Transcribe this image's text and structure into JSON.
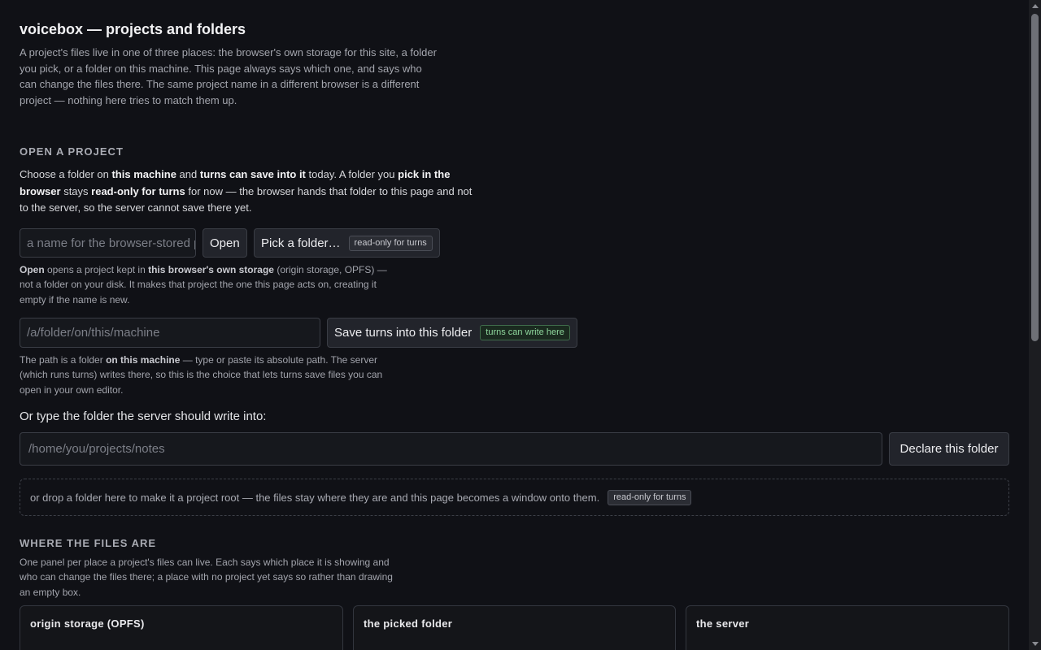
{
  "header": {
    "title": "voicebox — projects and folders",
    "intro": "A project's files live in one of three places: the browser's own storage for this site, a folder you pick, or a folder on this machine. This page always says which one, and says who can change the files there. The same project name in a different browser is a different project — nothing here tries to match them up."
  },
  "open_project": {
    "section_title": "OPEN A PROJECT",
    "lead": {
      "t1": "Choose a folder on ",
      "b1": "this machine",
      "t2": " and ",
      "b2": "turns can save into it",
      "t3": " today. A folder you ",
      "b3": "pick in the browser",
      "t4": " stays ",
      "b4": "read-only for turns",
      "t5": " for now — the browser hands that folder to this page and not to the server, so the server cannot save there yet."
    },
    "name_input_placeholder": "a name for the browser-stored project",
    "open_button": "Open",
    "pick_button": "Pick a folder…",
    "pick_badge": "read-only for turns",
    "open_help": {
      "b1": "Open",
      "t1": " opens a project kept in ",
      "b2": "this browser's own storage",
      "t2": " (origin storage, OPFS) — not a folder on your disk. It makes that project the one this page acts on, creating it empty if the name is new."
    },
    "path_input_placeholder": "/a/folder/on/this/machine",
    "save_button": "Save turns into this folder",
    "save_badge": "turns can write here",
    "path_help": {
      "t1": "The path is a folder ",
      "b1": "on this machine",
      "t2": " — type or paste its absolute path. The server (which runs turns) writes there, so this is the choice that lets turns save files you can open in your own editor."
    },
    "declare_label": "Or type the folder the server should write into:",
    "declare_input_placeholder": "/home/you/projects/notes",
    "declare_button": "Declare this folder",
    "dropzone_text": "or drop a folder here to make it a project root — the files stay where they are and this page becomes a window onto them.",
    "dropzone_badge": "read-only for turns"
  },
  "where_files": {
    "section_title": "WHERE THE FILES ARE",
    "help": "One panel per place a project's files can live. Each says which place it is showing and who can change the files there; a place with no project yet says so rather than drawing an empty box.",
    "panels": [
      {
        "title": "origin storage (OPFS)"
      },
      {
        "title": "the picked folder"
      },
      {
        "title": "the server"
      }
    ]
  },
  "icons": {
    "scroll_up": "chevron-up-icon",
    "scroll_down": "chevron-down-icon"
  },
  "colors": {
    "background": "#101116",
    "write_badge_text": "#8ed69c",
    "write_badge_border": "#3f6b4a"
  }
}
